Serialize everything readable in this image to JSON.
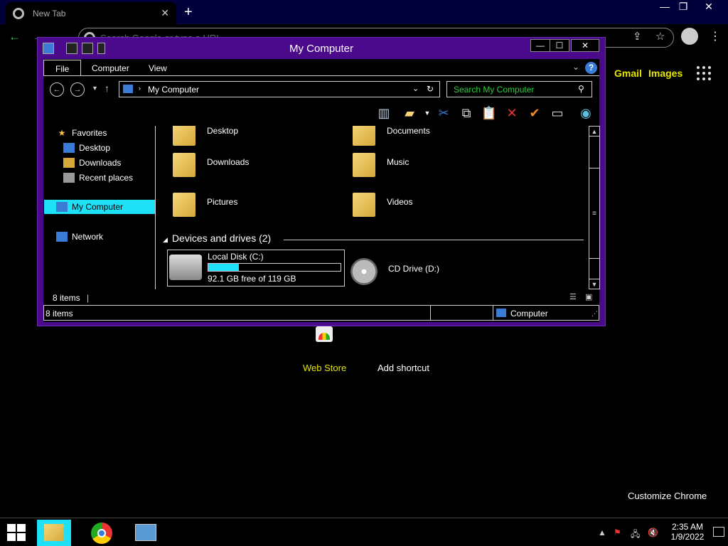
{
  "browser": {
    "tab_title": "New Tab",
    "omnibox_placeholder": "Search Google or type a URL",
    "ntp_links": {
      "gmail": "Gmail",
      "images": "Images"
    },
    "shortcuts": [
      {
        "label": "Web Store"
      },
      {
        "label": "Add shortcut"
      }
    ],
    "customize_label": "Customize Chrome",
    "accent_color": "#2ecc40"
  },
  "explorer": {
    "title": "My Computer",
    "ribbon_tabs": [
      "File",
      "Computer",
      "View"
    ],
    "address": "My Computer",
    "search_placeholder": "Search My Computer",
    "nav": {
      "favorites": "Favorites",
      "desktop": "Desktop",
      "downloads": "Downloads",
      "recent": "Recent places",
      "my_computer": "My Computer",
      "network": "Network"
    },
    "folders": [
      "Desktop",
      "Documents",
      "Downloads",
      "Music",
      "Pictures",
      "Videos"
    ],
    "group_header": "Devices and drives (2)",
    "drives": {
      "c_name": "Local Disk (C:)",
      "c_free": "92.1 GB free of 119 GB",
      "c_used_fraction": 0.23,
      "d_name": "CD Drive (D:)"
    },
    "item_count": "8 items",
    "status_count": "8 items",
    "status_location": "Computer",
    "selection_color": "#1ee0f7",
    "frame_color": "#4b0a8c"
  },
  "taskbar": {
    "time": "2:35 AM",
    "date": "1/9/2022"
  }
}
